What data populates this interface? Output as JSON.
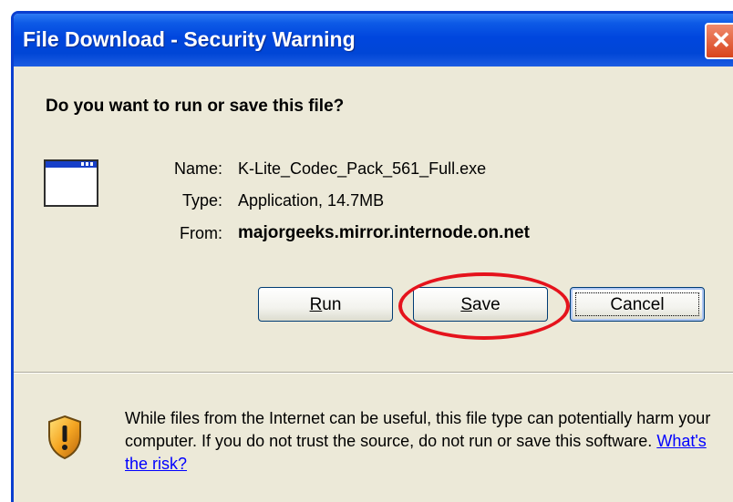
{
  "window": {
    "title": "File Download - Security Warning",
    "close_glyph": "✕"
  },
  "dialog": {
    "question": "Do you want to run or save this file?",
    "file_icon": "application-window-icon",
    "name_label": "Name:",
    "name_value": "K-Lite_Codec_Pack_561_Full.exe",
    "type_label": "Type:",
    "type_value": "Application, 14.7MB",
    "from_label": "From:",
    "from_value": "majorgeeks.mirror.internode.on.net"
  },
  "buttons": {
    "run_mnemonic": "R",
    "run_rest": "un",
    "save_mnemonic": "S",
    "save_rest": "ave",
    "cancel": "Cancel"
  },
  "highlight": {
    "color": "#e5131c",
    "target": "save-button"
  },
  "warning": {
    "icon": "warning-shield-icon",
    "text": "While files from the Internet can be useful, this file type can potentially harm your computer. If you do not trust the source, do not run or save this software.",
    "link": "What's the risk?"
  }
}
